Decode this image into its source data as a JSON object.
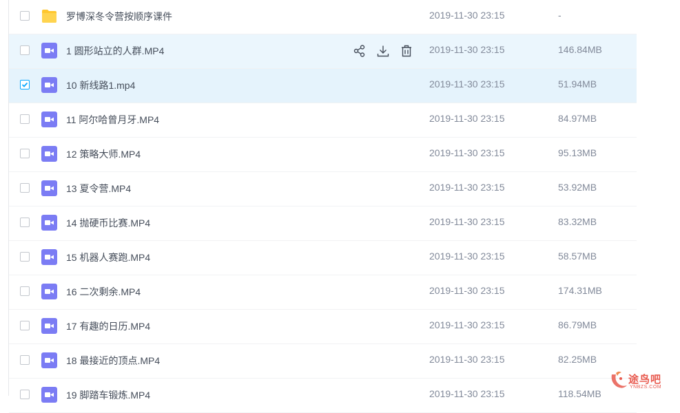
{
  "files": [
    {
      "name": "罗博深冬令营按顺序课件",
      "time": "2019-11-30 23:15",
      "size": "-",
      "type": "folder",
      "checked": false,
      "state": ""
    },
    {
      "name": "1 圆形站立的人群.MP4",
      "time": "2019-11-30 23:15",
      "size": "146.84MB",
      "type": "video",
      "checked": false,
      "state": "hovered"
    },
    {
      "name": "10 新线路1.mp4",
      "time": "2019-11-30 23:15",
      "size": "51.94MB",
      "type": "video",
      "checked": true,
      "state": "selected"
    },
    {
      "name": "11 阿尔哈曾月牙.MP4",
      "time": "2019-11-30 23:15",
      "size": "84.97MB",
      "type": "video",
      "checked": false,
      "state": ""
    },
    {
      "name": "12 策略大师.MP4",
      "time": "2019-11-30 23:15",
      "size": "95.13MB",
      "type": "video",
      "checked": false,
      "state": ""
    },
    {
      "name": "13 夏令营.MP4",
      "time": "2019-11-30 23:15",
      "size": "53.92MB",
      "type": "video",
      "checked": false,
      "state": ""
    },
    {
      "name": "14 抛硬币比赛.MP4",
      "time": "2019-11-30 23:15",
      "size": "83.32MB",
      "type": "video",
      "checked": false,
      "state": ""
    },
    {
      "name": "15 机器人赛跑.MP4",
      "time": "2019-11-30 23:15",
      "size": "58.57MB",
      "type": "video",
      "checked": false,
      "state": ""
    },
    {
      "name": "16 二次剩余.MP4",
      "time": "2019-11-30 23:15",
      "size": "174.31MB",
      "type": "video",
      "checked": false,
      "state": ""
    },
    {
      "name": "17 有趣的日历.MP4",
      "time": "2019-11-30 23:15",
      "size": "86.79MB",
      "type": "video",
      "checked": false,
      "state": ""
    },
    {
      "name": "18 最接近的顶点.MP4",
      "time": "2019-11-30 23:15",
      "size": "82.25MB",
      "type": "video",
      "checked": false,
      "state": ""
    },
    {
      "name": "19 脚踏车锻炼.MP4",
      "time": "2019-11-30 23:15",
      "size": "118.54MB",
      "type": "video",
      "checked": false,
      "state": ""
    }
  ],
  "row_actions": [
    "share-icon",
    "download-icon",
    "delete-icon"
  ],
  "icons": {
    "folder": "folder-icon",
    "video": "video-file-icon"
  },
  "colors": {
    "folder": "#ffc72e",
    "video": "#7b7cf4",
    "checkbox_checked": "#06a7ff",
    "hover_bg": "#ebf6fd",
    "selected_bg": "#e5f3fc"
  },
  "watermark": {
    "text": "途鸟吧",
    "sub": "YNBZS.COM"
  }
}
